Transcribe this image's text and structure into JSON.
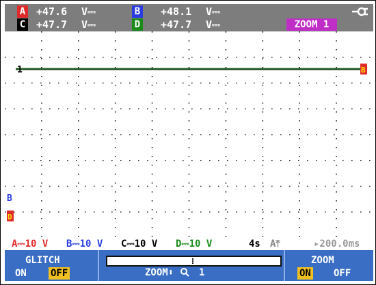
{
  "readouts": {
    "a": {
      "badge": "A",
      "value": "+47.6",
      "unit": "V⎓",
      "color": "#e02a2a"
    },
    "b": {
      "badge": "B",
      "value": "+48.1",
      "unit": "V⎓",
      "color": "#2a3ce0"
    },
    "c": {
      "badge": "C",
      "value": "+47.7",
      "unit": "V⎓",
      "color": "#000000"
    },
    "d": {
      "badge": "D",
      "value": "+47.7",
      "unit": "V⎓",
      "color": "#1a8a1a"
    }
  },
  "zoom_tag": "ZOOM 1",
  "power_icon": "mains-plug-icon",
  "markers": {
    "trace_left": "1",
    "trace_right": "B",
    "bottom_b": "B",
    "bottom_d": "D"
  },
  "scale": {
    "a": "A⎓10 V",
    "b": "B⎓10 V",
    "c": "C⎓10 V",
    "d": "D⎓10 V",
    "time": "4s",
    "trigger": "A⤒",
    "offset": "▸200.0ms"
  },
  "softkeys": {
    "glitch": {
      "title": "GLITCH",
      "on": "ON",
      "off": "OFF",
      "selected": "OFF"
    },
    "zoom_control": {
      "label": "ZOOM",
      "arrows": "⬍",
      "magnifier": "🔍",
      "level": "1"
    },
    "zoom": {
      "title": "ZOOM",
      "on": "ON",
      "off": "OFF",
      "selected": "ON"
    }
  },
  "colors": {
    "channel_a": "#e02a2a",
    "channel_b": "#2a3ce0",
    "channel_c": "#000000",
    "channel_d": "#1a8a1a",
    "trace": "#1f4a1f",
    "softkey_bg": "#3a6ec4",
    "selected_option": "#f0c020",
    "zoom_tag_bg": "#c02ec8",
    "readout_bg": "#7d7d7d"
  }
}
